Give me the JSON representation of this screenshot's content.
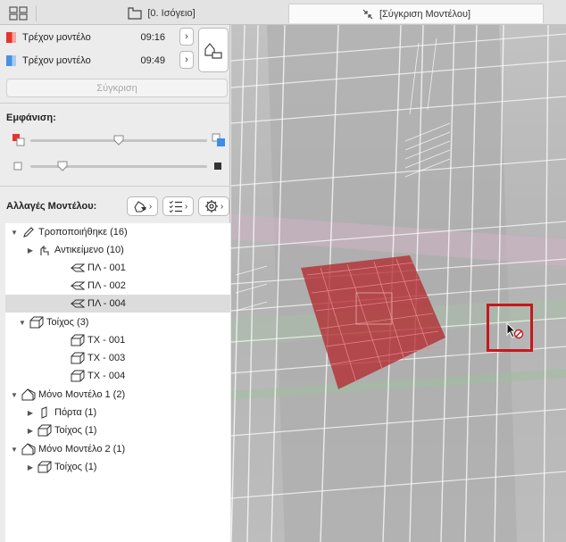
{
  "tabs": {
    "floor": "[0. Ισόγειο]",
    "compare": "[Σύγκριση Μοντέλου]"
  },
  "models": [
    {
      "label": "Τρέχον μοντέλο",
      "time": "09:16",
      "color": "#e8332a"
    },
    {
      "label": "Τρέχον μοντέλο",
      "time": "09:49",
      "color": "#4a90e2"
    }
  ],
  "compare_button": "Σύγκριση",
  "display_label": "Εμφάνιση:",
  "sliders": {
    "color_mix": 0.5,
    "opacity": 0.18
  },
  "changes_label": "Αλλαγές Μοντέλου:",
  "toolbar_icons": [
    "filter-icon",
    "list-icon",
    "gear-icon"
  ],
  "tree": [
    {
      "label": "Τροποποιήθηκε (16)"
    },
    {
      "label": "Αντικείμενο (10)"
    },
    {
      "label": "ΠΛ - 001"
    },
    {
      "label": "ΠΛ - 002"
    },
    {
      "label": "ΠΛ - 004"
    },
    {
      "label": "Τοίχος (3)"
    },
    {
      "label": "ΤΧ - 001"
    },
    {
      "label": "ΤΧ - 003"
    },
    {
      "label": "ΤΧ - 004"
    },
    {
      "label": "Μόνο Μοντέλο 1 (2)"
    },
    {
      "label": "Πόρτα (1)"
    },
    {
      "label": "Τοίχος (1)"
    },
    {
      "label": "Μόνο Μοντέλο 2 (1)"
    },
    {
      "label": "Τοίχος (1)"
    }
  ],
  "colors": {
    "highlight": "#c8171e",
    "changed_element": "#b3262a"
  }
}
